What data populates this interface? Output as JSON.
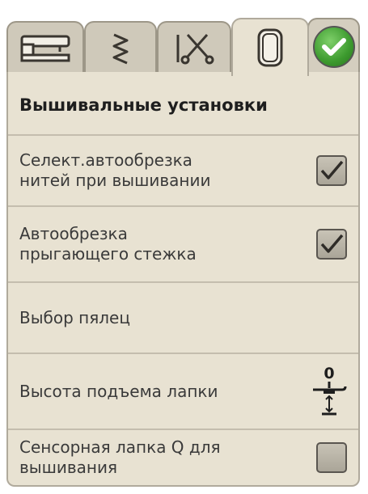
{
  "tabs": [
    {
      "icon": "sewing-machine-icon",
      "active": false
    },
    {
      "icon": "zigzag-stitch-icon",
      "active": false
    },
    {
      "icon": "needle-scissors-icon",
      "active": false
    },
    {
      "icon": "embroidery-hoop-icon",
      "active": true
    }
  ],
  "ok_button": {
    "icon": "checkmark-icon"
  },
  "header": {
    "title": "Вышивальные установки"
  },
  "settings": [
    {
      "label": "Селект.автообрезка\nнитей при вышивании",
      "control": "checkbox",
      "checked": true
    },
    {
      "label": "Автообрезка\nпрыгающего стежка",
      "control": "checkbox",
      "checked": true
    },
    {
      "label": "Выбор пялец",
      "control": "none"
    },
    {
      "label": "Высота подъема лапки",
      "control": "presser-foot-height",
      "value": "0"
    },
    {
      "label": "Сенсорная лапка Q для\nвышивания",
      "control": "checkbox",
      "checked": false
    }
  ],
  "colors": {
    "panel": "#e8e2d2",
    "tab_inactive": "#cfc9ba",
    "ok_green": "#3c9a2e",
    "divider": "#c4bdae"
  }
}
